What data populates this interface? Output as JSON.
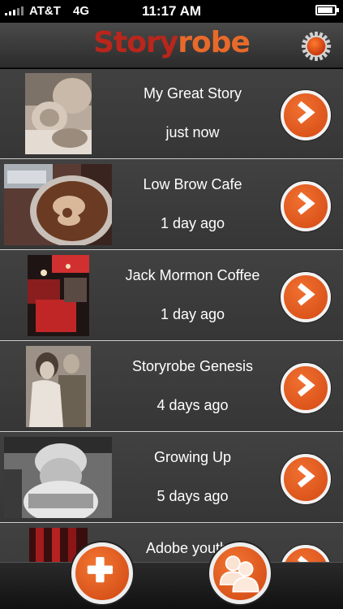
{
  "status_bar": {
    "carrier": "AT&T",
    "network": "4G",
    "time": "11:17 AM",
    "battery_level": 0.9
  },
  "app": {
    "logo_part1": "Story",
    "logo_part2": "robe",
    "colors": {
      "logo_red": "#b9261b",
      "accent_orange": "#e86a2a"
    }
  },
  "stories": [
    {
      "title": "My Great Story",
      "time": "just now",
      "thumb_icon": "newborn-photo"
    },
    {
      "title": "Low Brow Cafe",
      "time": "1 day ago",
      "thumb_icon": "latte-art-photo"
    },
    {
      "title": "Jack Mormon Coffee",
      "time": "1 day ago",
      "thumb_icon": "cafe-interior-photo"
    },
    {
      "title": "Storyrobe Genesis",
      "time": "4 days ago",
      "thumb_icon": "wedding-couple-photo"
    },
    {
      "title": "Growing Up",
      "time": "5 days ago",
      "thumb_icon": "baby-photo"
    },
    {
      "title": "Adobe youth v",
      "time": "",
      "thumb_icon": "red-interior-photo"
    }
  ],
  "toolbar": {
    "add_icon": "plus-icon",
    "profile_icon": "people-icon"
  }
}
